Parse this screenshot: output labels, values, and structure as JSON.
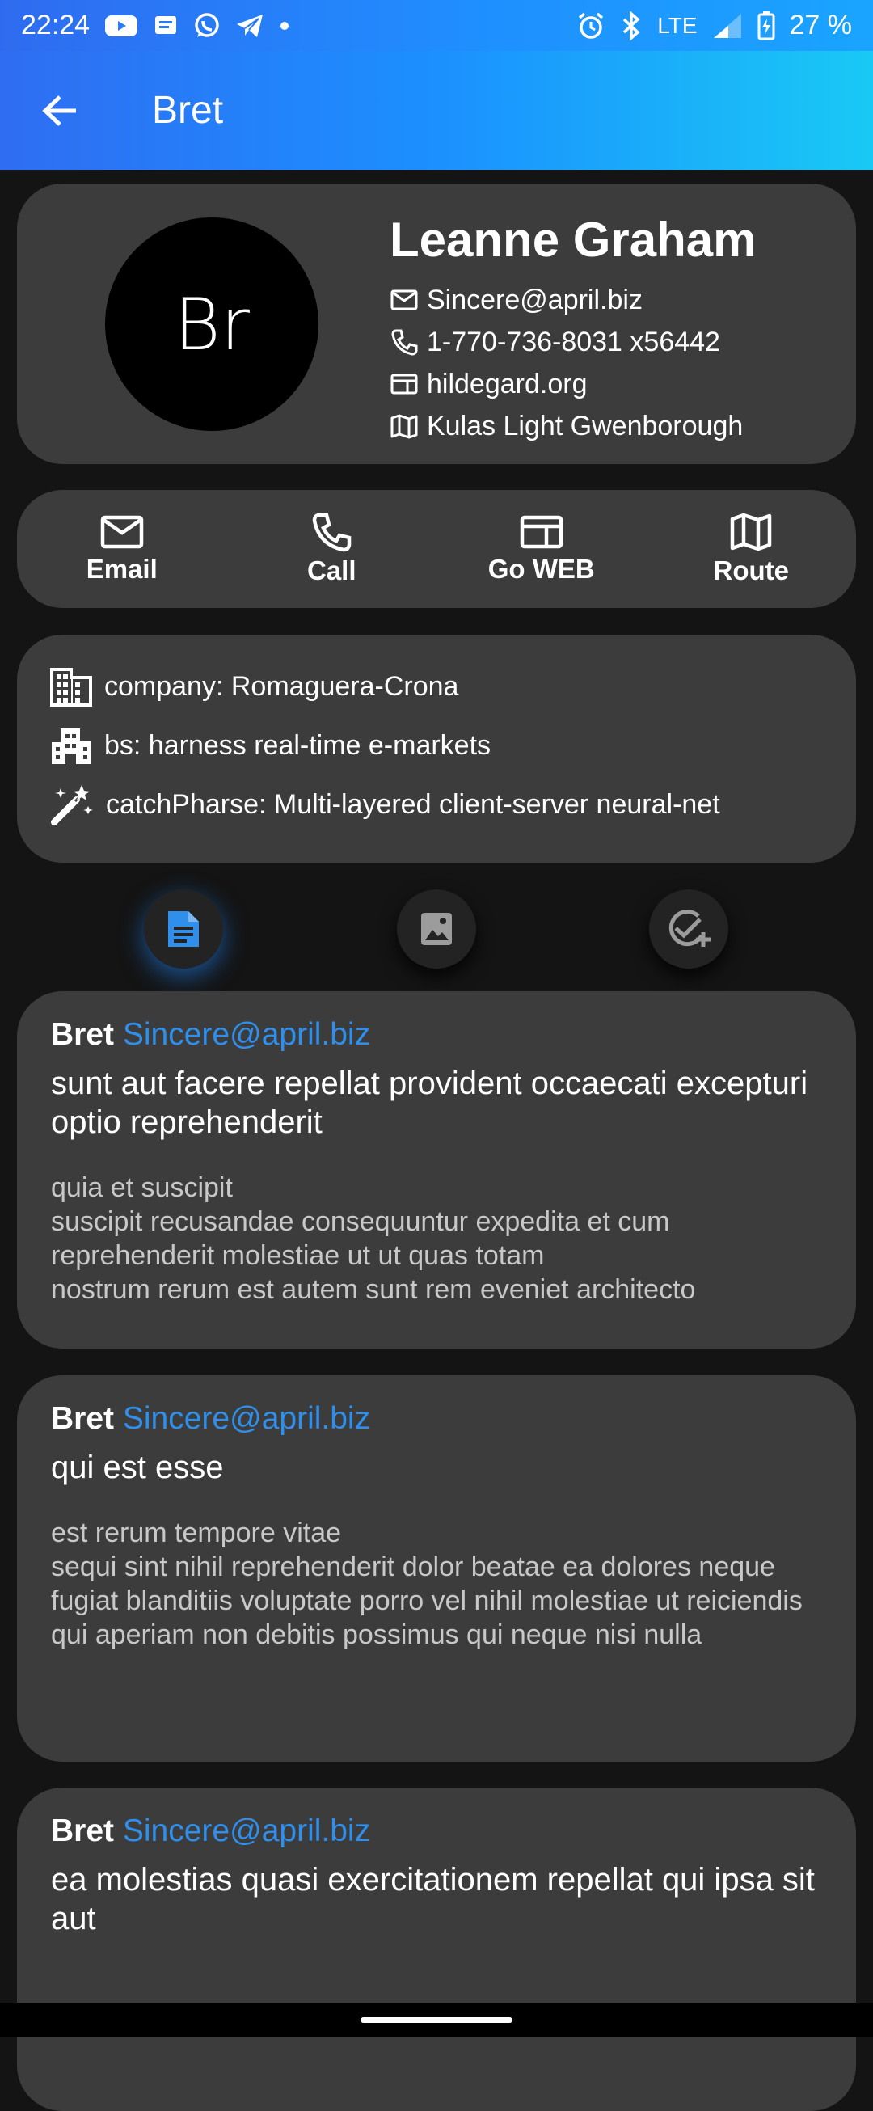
{
  "status_bar": {
    "time": "22:24",
    "network": "LTE",
    "battery": "27 %"
  },
  "app_bar": {
    "title": "Bret"
  },
  "profile": {
    "avatar_initials": "Br",
    "name": "Leanne Graham",
    "email": "Sincere@april.biz",
    "phone": "1-770-736-8031 x56442",
    "website": "hildegard.org",
    "address": "Kulas Light Gwenborough"
  },
  "actions": {
    "email": "Email",
    "call": "Call",
    "web": "Go WEB",
    "route": "Route"
  },
  "company": {
    "name": "company: Romaguera-Crona",
    "bs": "bs: harness real-time e-markets",
    "catch_phrase": "catchPharse: Multi-layered client-server neural-net"
  },
  "tabs": {
    "active_index": 0,
    "icons": [
      "article-icon",
      "photo-icon",
      "task-add-icon"
    ]
  },
  "posts": [
    {
      "user": "Bret",
      "email": "Sincere@april.biz",
      "title": "sunt aut facere repellat provident occaecati excepturi optio reprehenderit",
      "body": "quia et suscipit\nsuscipit recusandae consequuntur expedita et cum\nreprehenderit molestiae ut ut quas totam\nnostrum rerum est autem sunt rem eveniet architecto"
    },
    {
      "user": "Bret",
      "email": "Sincere@april.biz",
      "title": "qui est esse",
      "body": "est rerum tempore vitae\nsequi sint nihil reprehenderit dolor beatae ea dolores neque\nfugiat blanditiis voluptate porro vel nihil molestiae ut reiciendis\nqui aperiam non debitis possimus qui neque nisi nulla"
    },
    {
      "user": "Bret",
      "email": "Sincere@april.biz",
      "title": "ea molestias quasi exercitationem repellat qui ipsa sit aut",
      "body": ""
    }
  ],
  "colors": {
    "accent": "#2f8fea",
    "card": "#3c3c3c",
    "background": "#141414"
  }
}
